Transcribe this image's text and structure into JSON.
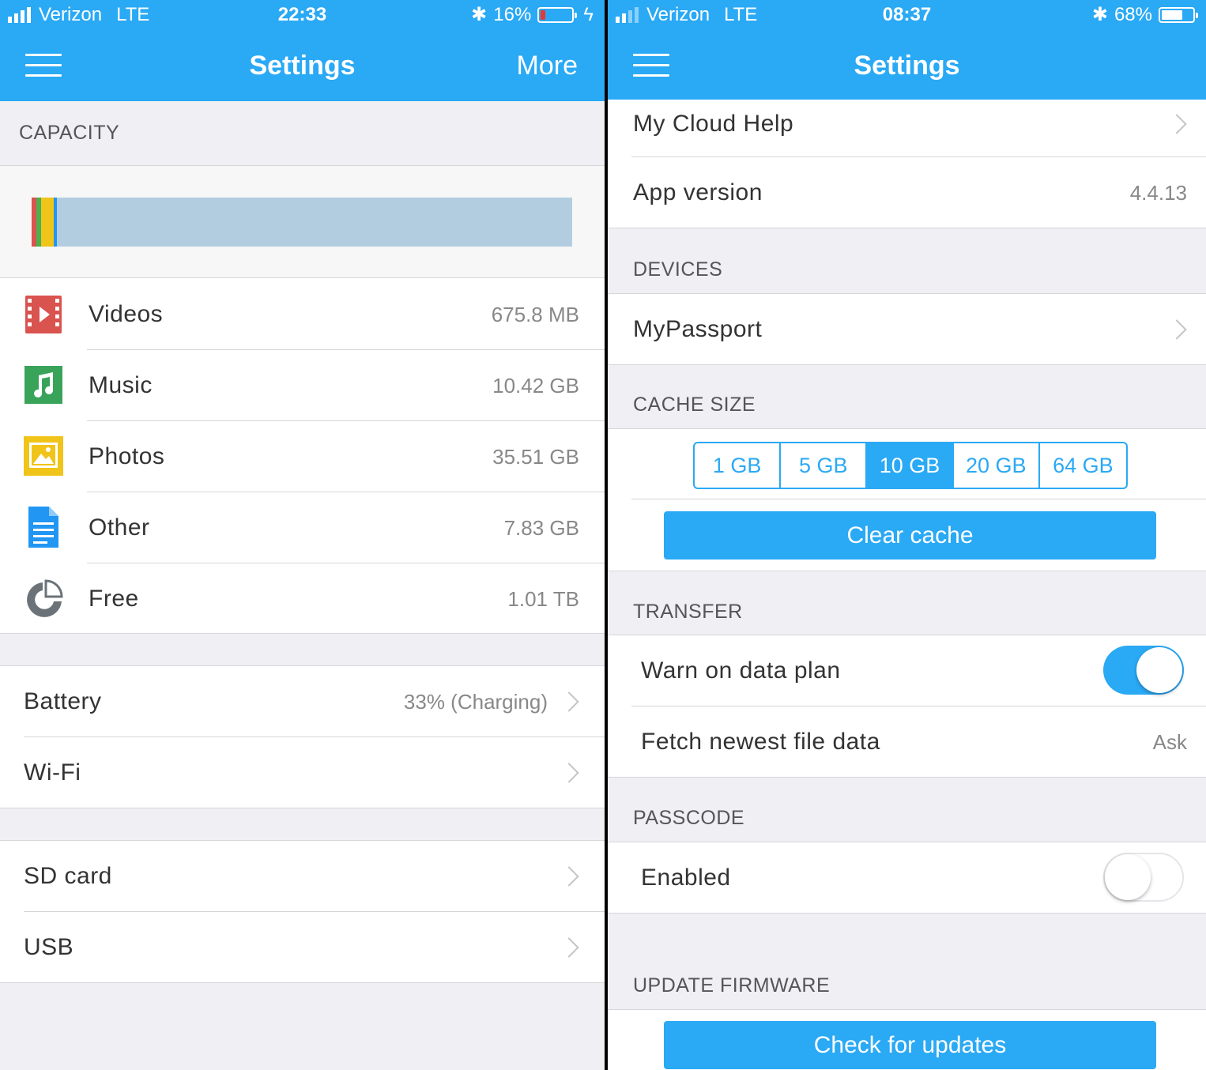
{
  "left": {
    "status": {
      "carrier": "Verizon",
      "network": "LTE",
      "time": "22:33",
      "battery_pct": "16%",
      "battery_level": 0.16
    },
    "nav": {
      "title": "Settings",
      "more": "More"
    },
    "capacity": {
      "header": "CAPACITY",
      "usage_bar": {
        "segments": [
          "#d9534f",
          "#4caf50",
          "#f0c419",
          "#2196f3"
        ]
      },
      "items": [
        {
          "label": "Videos",
          "value": "675.8 MB",
          "icon": "video-icon",
          "color": "#d9534f"
        },
        {
          "label": "Music",
          "value": "10.42 GB",
          "icon": "music-icon",
          "color": "#3aa35a"
        },
        {
          "label": "Photos",
          "value": "35.51 GB",
          "icon": "photo-icon",
          "color": "#f0c419"
        },
        {
          "label": "Other",
          "value": "7.83 GB",
          "icon": "document-icon",
          "color": "#2196f3"
        },
        {
          "label": "Free",
          "value": "1.01 TB",
          "icon": "pie-chart-icon",
          "color": "#6b7379"
        }
      ]
    },
    "device": [
      {
        "label": "Battery",
        "value": "33% (Charging)"
      },
      {
        "label": "Wi-Fi",
        "value": ""
      }
    ],
    "storage": [
      {
        "label": "SD card"
      },
      {
        "label": "USB"
      }
    ]
  },
  "right": {
    "status": {
      "carrier": "Verizon",
      "network": "LTE",
      "time": "08:37",
      "battery_pct": "68%",
      "battery_level": 0.68
    },
    "nav": {
      "title": "Settings"
    },
    "help": {
      "label": "My Cloud Help"
    },
    "app_version": {
      "label": "App version",
      "value": "4.4.13"
    },
    "devices": {
      "header": "DEVICES",
      "items": [
        {
          "label": "MyPassport"
        }
      ]
    },
    "cache": {
      "header": "CACHE SIZE",
      "options": [
        "1 GB",
        "5 GB",
        "10 GB",
        "20 GB",
        "64 GB"
      ],
      "selected": "10 GB",
      "clear_label": "Clear cache"
    },
    "transfer": {
      "header": "TRANSFER",
      "warn_label": "Warn on data plan",
      "warn_on": true,
      "fetch_label": "Fetch newest file data",
      "fetch_value": "Ask"
    },
    "passcode": {
      "header": "PASSCODE",
      "enabled_label": "Enabled",
      "enabled_on": false
    },
    "firmware": {
      "header": "UPDATE FIRMWARE",
      "check_label": "Check for updates"
    }
  },
  "colors": {
    "accent": "#2aa9f5",
    "background": "#efeff4"
  }
}
